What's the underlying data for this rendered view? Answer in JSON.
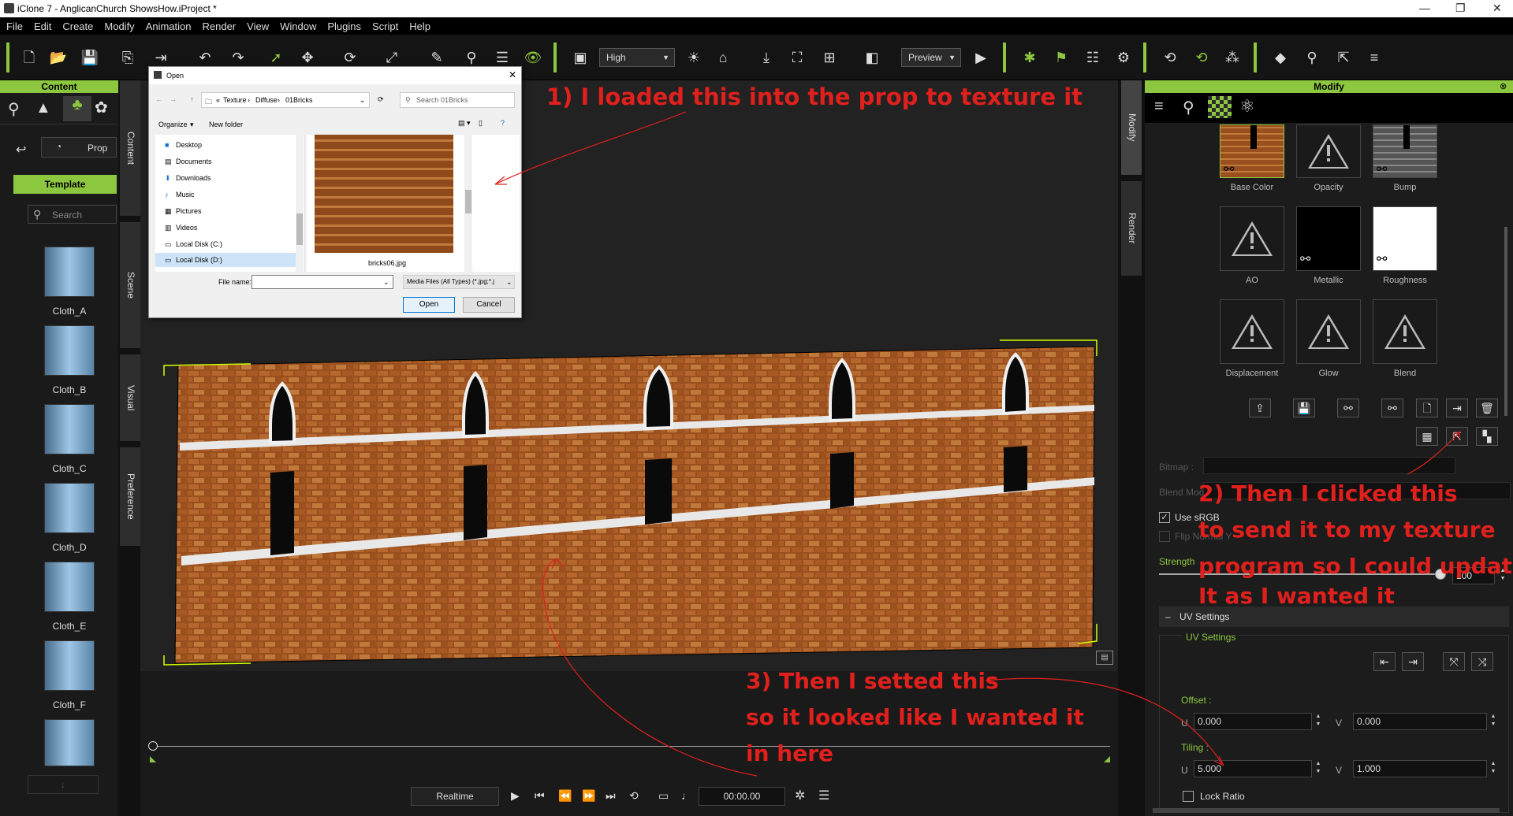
{
  "window": {
    "title": "iClone 7 - AnglicanChurch ShowsHow.iProject *"
  },
  "menu": [
    "File",
    "Edit",
    "Create",
    "Modify",
    "Animation",
    "Render",
    "View",
    "Window",
    "Plugins",
    "Script",
    "Help"
  ],
  "toolbar": {
    "quality": "High",
    "preview": "Preview"
  },
  "left_panel": {
    "header": "Content",
    "nav_label": "Prop",
    "template_label": "Template",
    "search_placeholder": "Search",
    "items": [
      "Cloth_A",
      "Cloth_B",
      "Cloth_C",
      "Cloth_D",
      "Cloth_E",
      "Cloth_F"
    ],
    "vertical_tabs": [
      "Content",
      "Scene",
      "Visual",
      "Preference"
    ]
  },
  "right_panel": {
    "header": "Modify",
    "vertical_tabs": [
      "Modify",
      "Render"
    ],
    "texture_slots": [
      "Base Color",
      "Opacity",
      "Bump",
      "AO",
      "Metallic",
      "Roughness",
      "Displacement",
      "Glow",
      "Blend"
    ],
    "bitmap_label": "Bitmap :",
    "blend_mode_label": "Blend Mode",
    "use_srgb_label": "Use sRGB",
    "flip_normal_label": "Flip Normal Y",
    "strength_label": "Strength",
    "strength_value": "100",
    "uv_settings_section": "UV Settings",
    "uv_settings_group": "UV Settings",
    "offset_label": "Offset :",
    "offset_u": "0.000",
    "offset_v": "0.000",
    "tiling_label": "Tiling :",
    "tiling_u": "5.000",
    "tiling_v": "1.000",
    "u_label": "U",
    "v_label": "V",
    "lock_ratio_label": "Lock Ratio"
  },
  "timeline": {
    "mode": "Realtime",
    "time": "00:00.00"
  },
  "dialog": {
    "title": "Open",
    "breadcrumb": [
      "Texture",
      "Diffuse",
      "01Bricks"
    ],
    "search_placeholder": "Search 01Bricks",
    "organize": "Organize",
    "new_folder": "New folder",
    "tree": [
      "Desktop",
      "Documents",
      "Downloads",
      "Music",
      "Pictures",
      "Videos",
      "Local Disk (C:)",
      "Local Disk (D:)"
    ],
    "file_name": "bricks06.jpg",
    "file_name_label": "File name:",
    "file_type": "Media Files (All Types) (*.jpg;*.j",
    "open_button": "Open",
    "cancel_button": "Cancel"
  },
  "annotations": {
    "a1": "1) I loaded this into the prop to texture it",
    "a2_lines": [
      "2) Then I clicked this",
      "to send it to my texture",
      "program so I could update",
      "It as I wanted it"
    ],
    "a3_lines": [
      "3) Then I setted this",
      "so it looked like I wanted it",
      "in here"
    ]
  },
  "colors": {
    "accent": "#8dc63f",
    "annotation": "#e0201c"
  }
}
